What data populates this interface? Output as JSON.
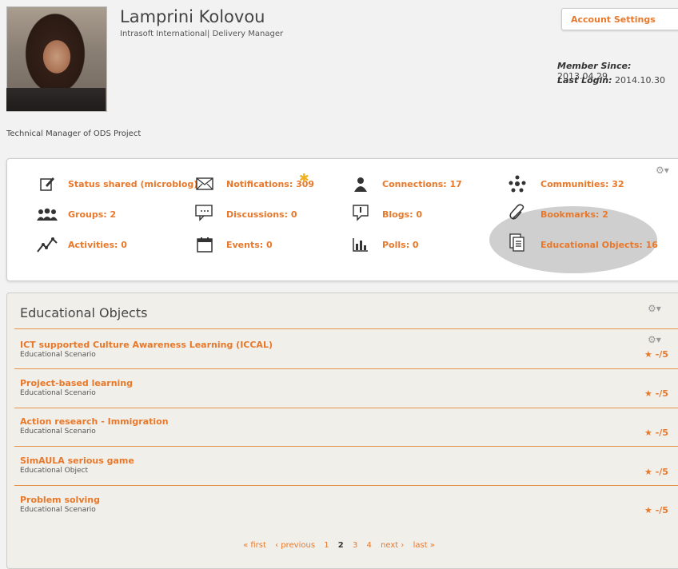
{
  "profile": {
    "name": "Lamprini Kolovou",
    "subtitle": "Intrasoft International| Delivery Manager",
    "about": "Technical Manager of ODS Project",
    "account_settings": "Account Settings",
    "member_since_label": "Member Since:",
    "member_since": "2013.04.29",
    "last_login_label": "Last Login:",
    "last_login": "2014.10.30"
  },
  "stats": [
    {
      "label": "Status shared (microblog)",
      "icon": "edit-icon"
    },
    {
      "label": "Notifications: 309",
      "icon": "envelope-icon"
    },
    {
      "label": "Connections: 17",
      "icon": "person-icon"
    },
    {
      "label": "Communities: 32",
      "icon": "community-icon"
    },
    {
      "label": "Groups: 2",
      "icon": "group-icon"
    },
    {
      "label": "Discussions: 0",
      "icon": "discussion-icon"
    },
    {
      "label": "Blogs: 0",
      "icon": "blog-icon"
    },
    {
      "label": "Bookmarks: 2",
      "icon": "paperclip-icon"
    },
    {
      "label": "Activities: 0",
      "icon": "activity-icon"
    },
    {
      "label": "Events: 0",
      "icon": "calendar-icon"
    },
    {
      "label": "Polls: 0",
      "icon": "poll-icon"
    },
    {
      "label": "Educational Objects: 16",
      "icon": "documents-icon"
    }
  ],
  "panel": {
    "title": "Educational Objects",
    "items": [
      {
        "title": "ICT supported Culture Awareness Learning (ICCAL)",
        "type": "Educational Scenario",
        "rating": "-/5"
      },
      {
        "title": "Project-based learning",
        "type": "Educational Scenario",
        "rating": "-/5"
      },
      {
        "title": "Action research - Immigration",
        "type": "Educational Scenario",
        "rating": "-/5"
      },
      {
        "title": "SimAULA serious game",
        "type": "Educational Object",
        "rating": "-/5"
      },
      {
        "title": "Problem solving",
        "type": "Educational Scenario",
        "rating": "-/5"
      }
    ]
  },
  "pager": {
    "first": "« first",
    "previous": "‹ previous",
    "pages": [
      "1",
      "2",
      "3",
      "4"
    ],
    "current": "2",
    "next": "next ›",
    "last": "last »"
  },
  "colors": {
    "accent": "#e8782a",
    "background": "#f2f2f2",
    "highlight": "#cfcfcf"
  }
}
